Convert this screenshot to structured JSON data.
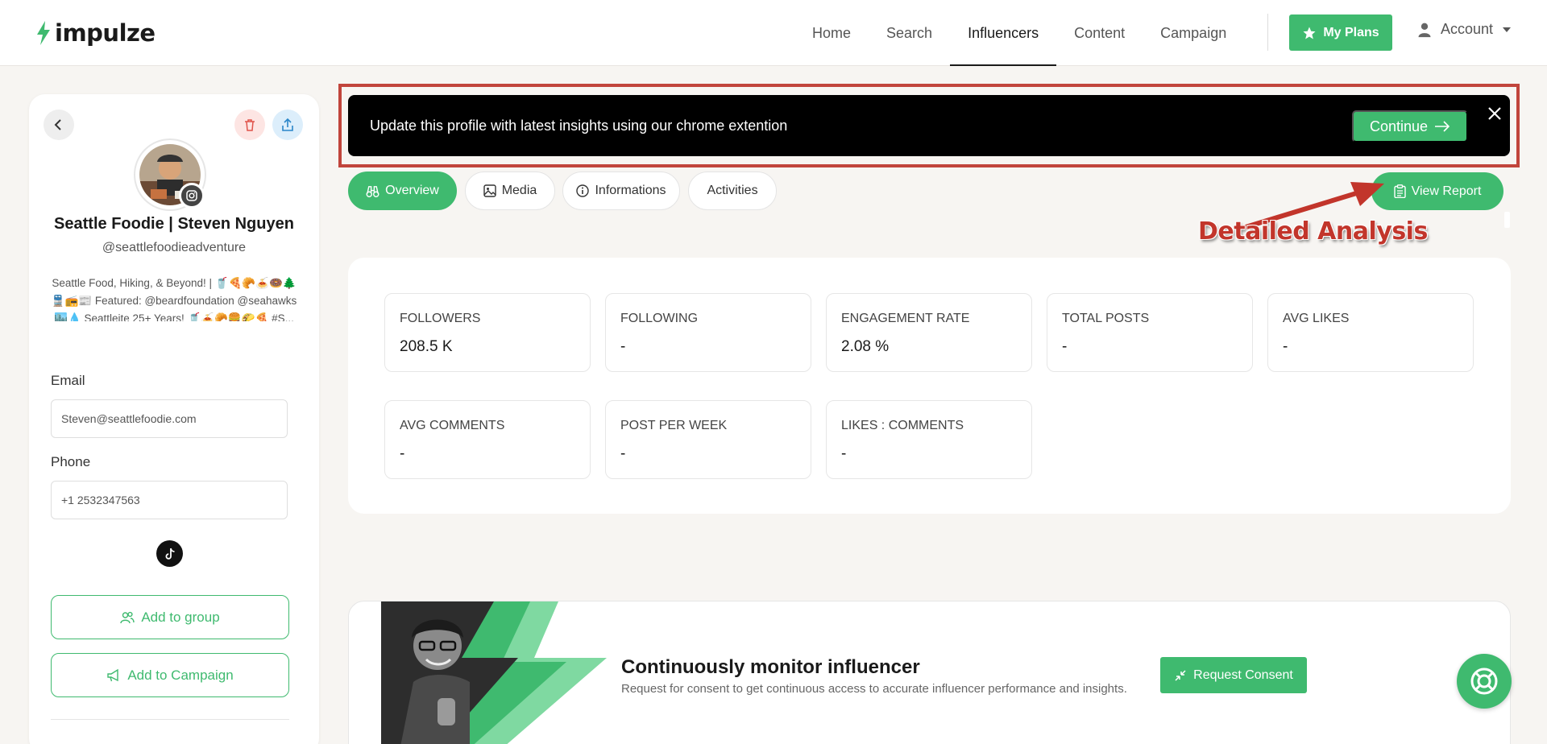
{
  "brand": {
    "name": "impulze",
    "accent": "#3fba6f"
  },
  "nav": {
    "items": [
      {
        "label": "Home",
        "active": false
      },
      {
        "label": "Search",
        "active": false
      },
      {
        "label": "Influencers",
        "active": true
      },
      {
        "label": "Content",
        "active": false
      },
      {
        "label": "Campaign",
        "active": false
      }
    ],
    "plans_label": "My Plans",
    "account_label": "Account"
  },
  "profile": {
    "name": "Seattle Foodie | Steven Nguyen",
    "handle": "@seattlefoodieadventure",
    "bio": "Seattle Food, Hiking, & Beyond! | 🥤🍕🥐🍝🍩🌲 🚆📻📰 Featured: @beardfoundation @seahawks 🏙️💧 Seattleite 25+ Years! 🥤🍝🥐🍔🌮🍕 #S...",
    "email_label": "Email",
    "email_value": "Steven@seattlefoodie.com",
    "phone_label": "Phone",
    "phone_value": "+1 2532347563",
    "add_group_label": "Add to group",
    "add_campaign_label": "Add to Campaign"
  },
  "banner": {
    "text": "Update this profile with latest insights using our chrome extention",
    "continue_label": "Continue"
  },
  "tabs": [
    {
      "label": "Overview",
      "icon": "binoculars-icon",
      "active": true
    },
    {
      "label": "Media",
      "icon": "image-icon",
      "active": false
    },
    {
      "label": "Informations",
      "icon": "info-icon",
      "active": false
    },
    {
      "label": "Activities",
      "icon": "",
      "active": false
    }
  ],
  "view_report_label": "View Report",
  "annotation_text": "Detailed Analysis",
  "stats": [
    {
      "label": "FOLLOWERS",
      "value": "208.5 K"
    },
    {
      "label": "FOLLOWING",
      "value": "-"
    },
    {
      "label": "ENGAGEMENT RATE",
      "value": "2.08 %"
    },
    {
      "label": "TOTAL POSTS",
      "value": "-"
    },
    {
      "label": "AVG LIKES",
      "value": "-"
    },
    {
      "label": "AVG COMMENTS",
      "value": "-"
    },
    {
      "label": "POST PER WEEK",
      "value": "-"
    },
    {
      "label": "LIKES : COMMENTS",
      "value": "-"
    }
  ],
  "monitor": {
    "title": "Continuously monitor influencer",
    "description": "Request for consent to get continuous access to accurate influencer performance and insights.",
    "button_label": "Request Consent"
  }
}
